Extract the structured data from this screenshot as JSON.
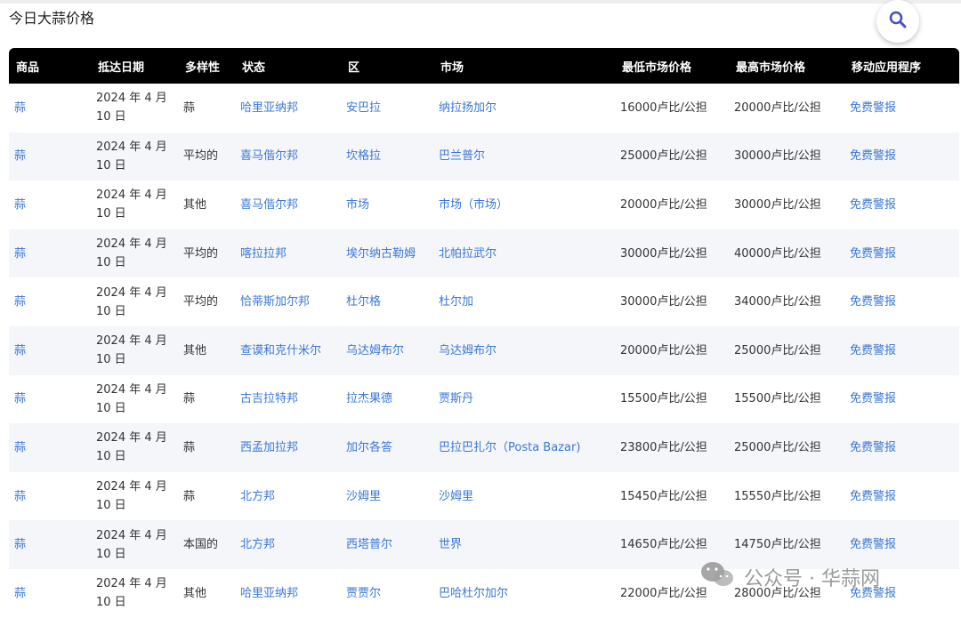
{
  "page": {
    "title": "今日大蒜价格"
  },
  "table": {
    "headers": [
      "商品",
      "抵达日期",
      "多样性",
      "状态",
      "区",
      "市场",
      "最低市场价格",
      "最高市场价格",
      "移动应用程序"
    ],
    "rows": [
      {
        "commodity": "蒜",
        "date": "2024 年 4 月 10 日",
        "variety": "蒜",
        "state": "哈里亚纳邦",
        "district": "安巴拉",
        "market": "纳拉扬加尔",
        "min_price": "16000卢比/公担",
        "max_price": "20000卢比/公担",
        "app": "免费警报"
      },
      {
        "commodity": "蒜",
        "date": "2024 年 4 月 10 日",
        "variety": "平均的",
        "state": "喜马偕尔邦",
        "district": "坎格拉",
        "market": "巴兰普尔",
        "min_price": "25000卢比/公担",
        "max_price": "30000卢比/公担",
        "app": "免费警报"
      },
      {
        "commodity": "蒜",
        "date": "2024 年 4 月 10 日",
        "variety": "其他",
        "state": "喜马偕尔邦",
        "district": "市场",
        "market": "市场（市场）",
        "min_price": "20000卢比/公担",
        "max_price": "30000卢比/公担",
        "app": "免费警报"
      },
      {
        "commodity": "蒜",
        "date": "2024 年 4 月 10 日",
        "variety": "平均的",
        "state": "喀拉拉邦",
        "district": "埃尔纳古勒姆",
        "market": "北帕拉武尔",
        "min_price": "30000卢比/公担",
        "max_price": "40000卢比/公担",
        "app": "免费警报"
      },
      {
        "commodity": "蒜",
        "date": "2024 年 4 月 10 日",
        "variety": "平均的",
        "state": "恰蒂斯加尔邦",
        "district": "杜尔格",
        "market": "杜尔加",
        "min_price": "30000卢比/公担",
        "max_price": "34000卢比/公担",
        "app": "免费警报"
      },
      {
        "commodity": "蒜",
        "date": "2024 年 4 月 10 日",
        "variety": "其他",
        "state": "查谟和克什米尔",
        "district": "乌达姆布尔",
        "market": "乌达姆布尔",
        "min_price": "20000卢比/公担",
        "max_price": "25000卢比/公担",
        "app": "免费警报"
      },
      {
        "commodity": "蒜",
        "date": "2024 年 4 月 10 日",
        "variety": "蒜",
        "state": "古吉拉特邦",
        "district": "拉杰果德",
        "market": "贾斯丹",
        "min_price": "15500卢比/公担",
        "max_price": "15500卢比/公担",
        "app": "免费警报"
      },
      {
        "commodity": "蒜",
        "date": "2024 年 4 月 10 日",
        "variety": "蒜",
        "state": "西孟加拉邦",
        "district": "加尔各答",
        "market": "巴拉巴扎尔（Posta Bazar)",
        "min_price": "23800卢比/公担",
        "max_price": "25000卢比/公担",
        "app": "免费警报"
      },
      {
        "commodity": "蒜",
        "date": "2024 年 4 月 10 日",
        "variety": "蒜",
        "state": "北方邦",
        "district": "沙姆里",
        "market": "沙姆里",
        "min_price": "15450卢比/公担",
        "max_price": "15550卢比/公担",
        "app": "免费警报"
      },
      {
        "commodity": "蒜",
        "date": "2024 年 4 月 10 日",
        "variety": "本国的",
        "state": "北方邦",
        "district": "西塔普尔",
        "market": "世界",
        "min_price": "14650卢比/公担",
        "max_price": "14750卢比/公担",
        "app": "免费警报"
      },
      {
        "commodity": "蒜",
        "date": "2024 年 4 月 10 日",
        "variety": "其他",
        "state": "哈里亚纳邦",
        "district": "贾贾尔",
        "market": "巴哈杜尔加尔",
        "min_price": "22000卢比/公担",
        "max_price": "28000卢比/公担",
        "app": "免费警报"
      }
    ]
  },
  "watermark": {
    "text": "公众号 · 华蒜网",
    "icon": "wechat-icon"
  },
  "icons": {
    "search": "search-icon"
  },
  "colors": {
    "header_bg": "#000000",
    "link": "#3a78d8",
    "row_alt": "#f5f6fa",
    "search_icon": "#4a4fc4"
  }
}
